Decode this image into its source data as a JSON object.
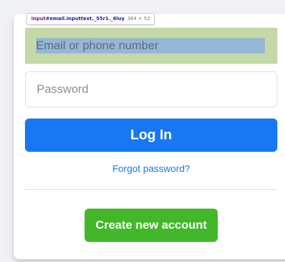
{
  "login_form": {
    "email": {
      "value": "",
      "placeholder": "Email or phone number"
    },
    "password": {
      "value": "",
      "placeholder": "Password"
    },
    "login_label": "Log In",
    "forgot_label": "Forgot password?",
    "create_label": "Create new account"
  },
  "devtools_tooltip": {
    "tag": "input",
    "selector": "#email.inputtext._55r1._6luy",
    "size": "364 × 52"
  },
  "colors": {
    "page_background": "#f0f2f5",
    "primary_blue": "#1877f2",
    "create_green": "#42b72a",
    "inspect_highlight": "#c4d9a5"
  }
}
